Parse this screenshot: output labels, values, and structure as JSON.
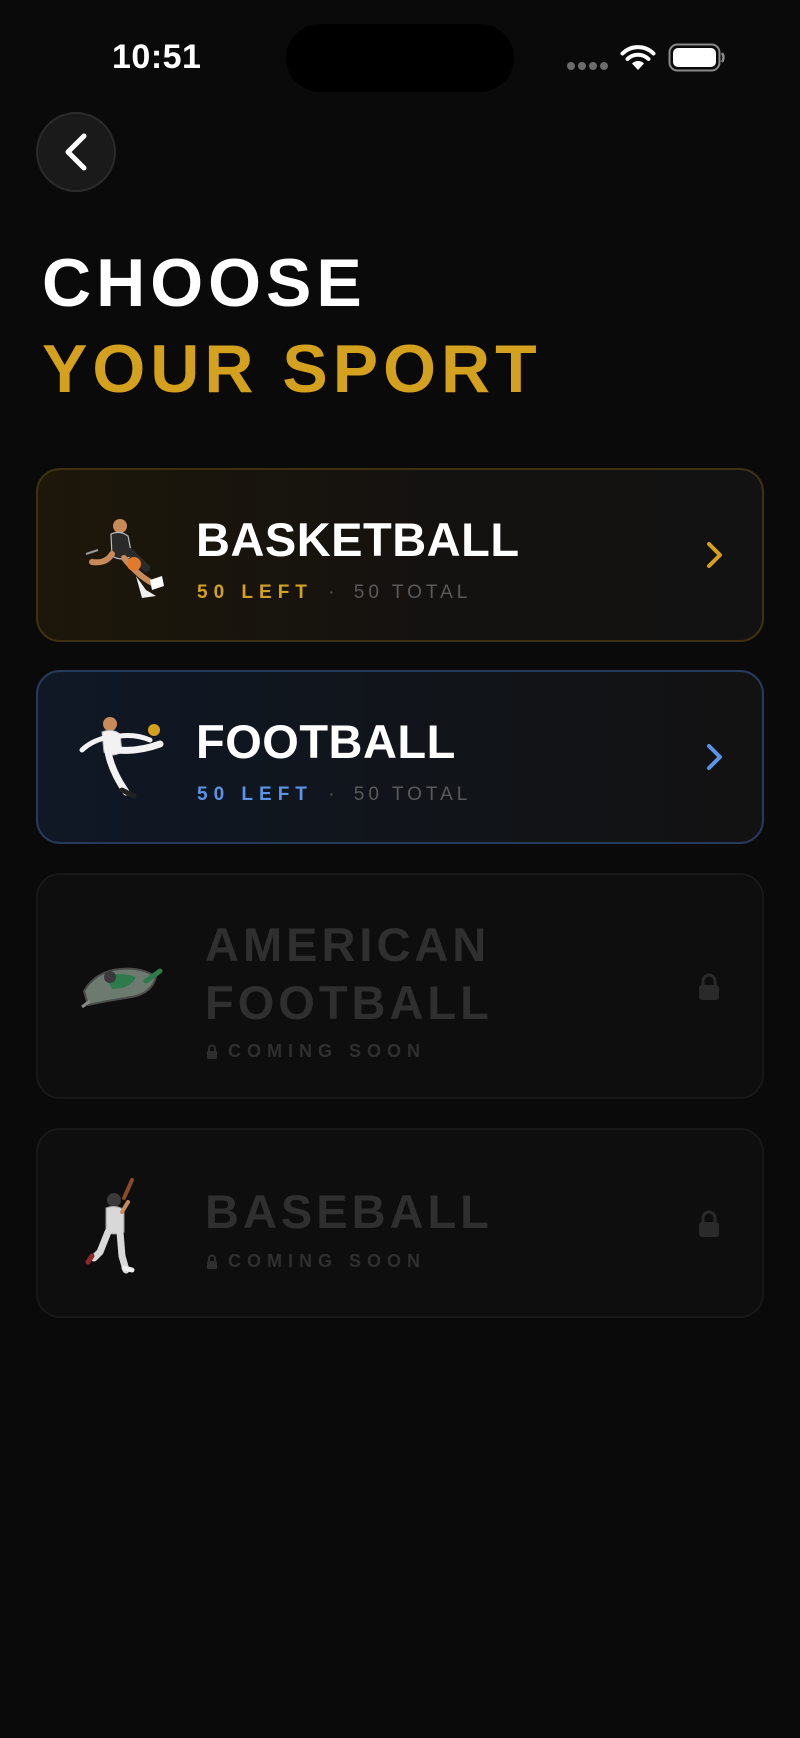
{
  "status_bar": {
    "time": "10:51"
  },
  "header": {
    "back_icon": "chevron-left-icon",
    "title_line1": "CHOOSE",
    "title_line2": "YOUR SPORT"
  },
  "colors": {
    "accent_gold": "#d4a11e",
    "accent_blue": "#5b93e6",
    "background": "#0a0a0a",
    "locked_text": "#2f2f2f"
  },
  "sports": [
    {
      "name": "BASKETBALL",
      "left": "50 LEFT",
      "separator": "·",
      "total": "50 TOTAL",
      "icon": "chevron-right-icon",
      "accent": "#d4a11e"
    },
    {
      "name": "FOOTBALL",
      "left": "50 LEFT",
      "separator": "·",
      "total": "50 TOTAL",
      "icon": "chevron-right-icon",
      "accent": "#5b93e6"
    },
    {
      "name_line1": "AMERICAN",
      "name_line2": "FOOTBALL",
      "status": "COMING SOON",
      "icon": "lock-icon"
    },
    {
      "name": "BASEBALL",
      "status": "COMING SOON",
      "icon": "lock-icon"
    }
  ]
}
